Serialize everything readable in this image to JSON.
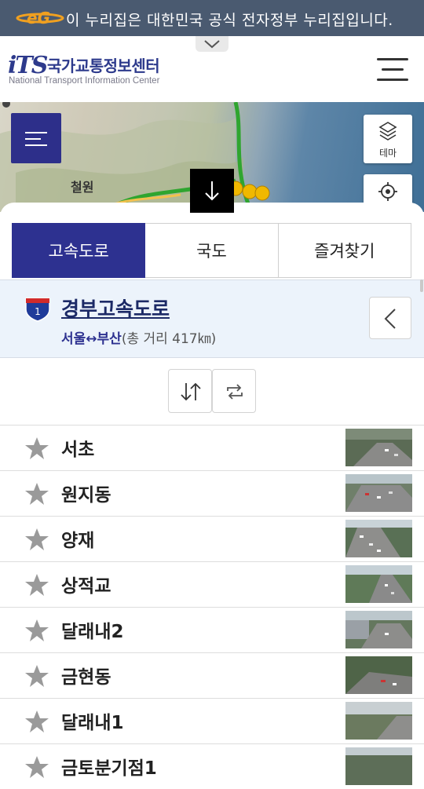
{
  "gov_banner": {
    "text": "이 누리집은 대한민국 공식 전자정부 누리집입니다."
  },
  "header": {
    "logo_mark": "iTS",
    "logo_title": "국가교통정보센터",
    "logo_subtitle": "National Transport Information Center"
  },
  "map": {
    "place_label": "철원",
    "theme_button_label": "테마"
  },
  "tabs": [
    {
      "label": "고속도로",
      "active": true
    },
    {
      "label": "국도",
      "active": false
    },
    {
      "label": "즐겨찾기",
      "active": false
    }
  ],
  "route": {
    "number": "1",
    "name": "경부고속도로",
    "endpoints": "서울↔부산",
    "distance": "(총 거리 417㎞)"
  },
  "cctv_list": [
    {
      "name": "서초",
      "favorite": false
    },
    {
      "name": "원지동",
      "favorite": false
    },
    {
      "name": "양재",
      "favorite": false
    },
    {
      "name": "상적교",
      "favorite": false
    },
    {
      "name": "달래내2",
      "favorite": false
    },
    {
      "name": "금현동",
      "favorite": false
    },
    {
      "name": "달래내1",
      "favorite": false
    },
    {
      "name": "금토분기점1",
      "favorite": false
    }
  ],
  "colors": {
    "primary": "#2d3190",
    "gov_banner_bg": "#4a5a70",
    "route_bar_bg": "#ecf3fb",
    "star_gray": "#9a9a9a"
  },
  "icons": [
    "hamburger-menu-icon",
    "chevron-down-icon",
    "layers-icon",
    "locate-icon",
    "arrow-down-icon",
    "swap-vertical-icon",
    "refresh-icon",
    "chevron-left-icon",
    "star-icon",
    "highway-shield-icon"
  ]
}
